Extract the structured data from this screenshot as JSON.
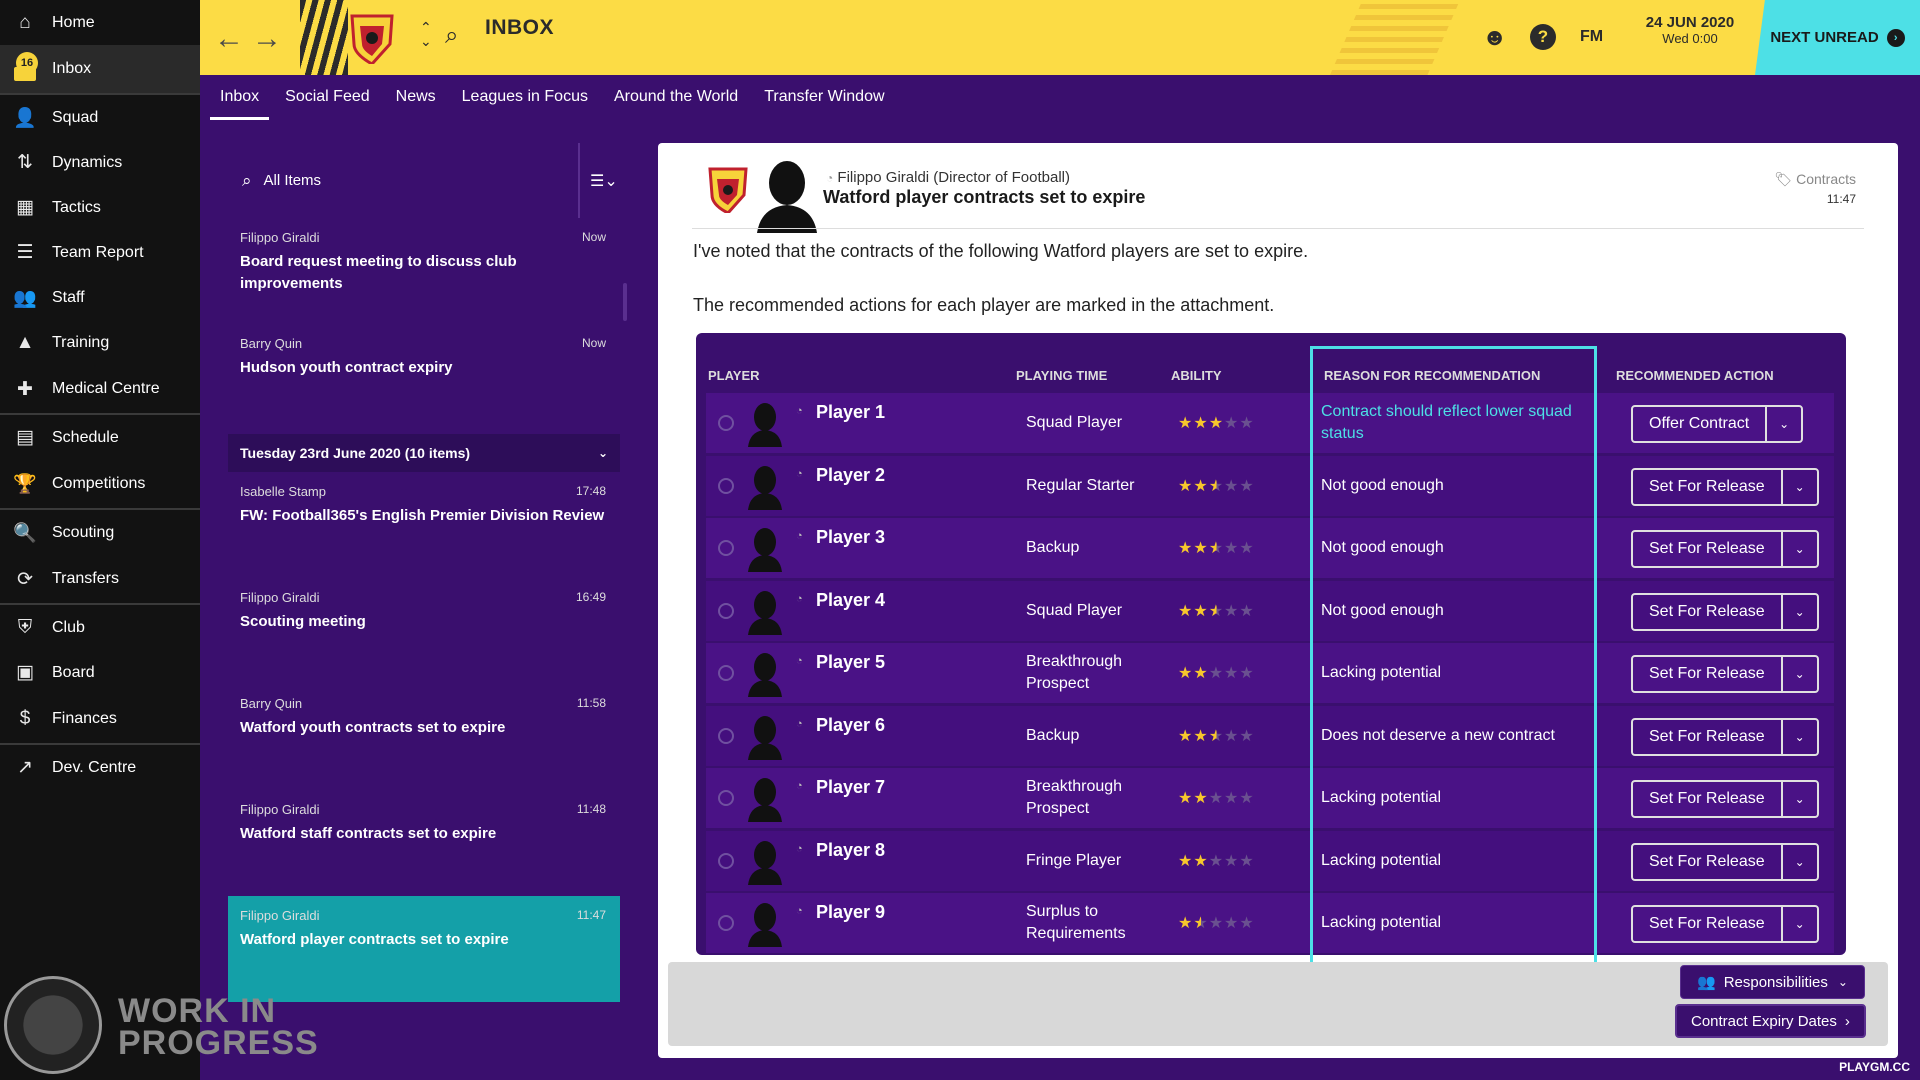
{
  "sidebar": {
    "items": [
      {
        "label": "Home",
        "icon": "home-icon",
        "glyph": "⌂"
      },
      {
        "label": "Inbox",
        "icon": "inbox-icon",
        "badge": "16"
      },
      {
        "label": "Squad",
        "icon": "squad-icon",
        "glyph": "👤"
      },
      {
        "label": "Dynamics",
        "icon": "dynamics-icon",
        "glyph": "⇅"
      },
      {
        "label": "Tactics",
        "icon": "tactics-icon",
        "glyph": "▦"
      },
      {
        "label": "Team Report",
        "icon": "report-icon",
        "glyph": "☰"
      },
      {
        "label": "Staff",
        "icon": "staff-icon",
        "glyph": "👥"
      },
      {
        "label": "Training",
        "icon": "training-icon",
        "glyph": "▲"
      },
      {
        "label": "Medical Centre",
        "icon": "medical-icon",
        "glyph": "✚"
      },
      {
        "label": "Schedule",
        "icon": "schedule-icon",
        "glyph": "▤"
      },
      {
        "label": "Competitions",
        "icon": "trophy-icon",
        "glyph": "🏆"
      },
      {
        "label": "Scouting",
        "icon": "scouting-icon",
        "glyph": "🔍"
      },
      {
        "label": "Transfers",
        "icon": "transfers-icon",
        "glyph": "⟳"
      },
      {
        "label": "Club",
        "icon": "club-icon",
        "glyph": "⛨"
      },
      {
        "label": "Board",
        "icon": "board-icon",
        "glyph": "▣"
      },
      {
        "label": "Finances",
        "icon": "finances-icon",
        "glyph": "$"
      },
      {
        "label": "Dev. Centre",
        "icon": "dev-centre-icon",
        "glyph": "↗"
      }
    ]
  },
  "header": {
    "title": "INBOX",
    "fm_label": "FM",
    "date": "24 JUN 2020",
    "day_time": "Wed 0:00",
    "next_unread": "NEXT UNREAD"
  },
  "tabs": [
    "Inbox",
    "Social Feed",
    "News",
    "Leagues in Focus",
    "Around the World",
    "Transfer Window"
  ],
  "list": {
    "search_label": "All Items",
    "messages_top": [
      {
        "from": "Filippo Giraldi",
        "time": "Now",
        "subject": "Board request meeting to discuss club improvements"
      },
      {
        "from": "Barry Quin",
        "time": "Now",
        "subject": "Hudson youth contract expiry"
      }
    ],
    "group_label": "Tuesday 23rd June 2020 (10 items)",
    "messages_group": [
      {
        "from": "Isabelle Stamp",
        "time": "17:48",
        "subject": "FW: Football365's English Premier Division Review"
      },
      {
        "from": "Filippo Giraldi",
        "time": "16:49",
        "subject": "Scouting meeting"
      },
      {
        "from": "Barry Quin",
        "time": "11:58",
        "subject": "Watford youth contracts set to expire"
      },
      {
        "from": "Filippo Giraldi",
        "time": "11:48",
        "subject": "Watford staff contracts set to expire"
      },
      {
        "from": "Filippo Giraldi",
        "time": "11:47",
        "subject": "Watford player contracts set to expire"
      }
    ]
  },
  "detail": {
    "from_name": "Filippo Giraldi",
    "from_role": "(Director of Football)",
    "subject": "Watford player contracts set to expire",
    "tag": "Contracts",
    "time": "11:47",
    "para1": "I've noted that the contracts of the following Watford players are set to expire.",
    "para2": "The recommended actions for each player are marked in the attachment."
  },
  "table": {
    "headers": {
      "player": "PLAYER",
      "time": "PLAYING TIME",
      "ability": "ABILITY",
      "reason": "REASON FOR RECOMMENDATION",
      "action": "RECOMMENDED ACTION"
    },
    "rows": [
      {
        "name": "Player 1",
        "time": "Squad Player",
        "stars": 3,
        "reason": "Contract should reflect lower squad status",
        "action": "Offer Contract",
        "highlight": true
      },
      {
        "name": "Player 2",
        "time": "Regular Starter",
        "stars": 2.5,
        "reason": "Not good enough",
        "action": "Set For Release"
      },
      {
        "name": "Player 3",
        "time": "Backup",
        "stars": 2.5,
        "reason": "Not good enough",
        "action": "Set For Release"
      },
      {
        "name": "Player 4",
        "time": "Squad Player",
        "stars": 2.5,
        "reason": "Not good enough",
        "action": "Set For Release"
      },
      {
        "name": "Player 5",
        "time": "Breakthrough Prospect",
        "stars": 2,
        "reason": "Lacking potential",
        "action": "Set For Release"
      },
      {
        "name": "Player 6",
        "time": "Backup",
        "stars": 2.5,
        "reason": "Does not deserve a new contract",
        "action": "Set For Release"
      },
      {
        "name": "Player 7",
        "time": "Breakthrough Prospect",
        "stars": 2,
        "reason": "Lacking potential",
        "action": "Set For Release"
      },
      {
        "name": "Player 8",
        "time": "Fringe Player",
        "stars": 2,
        "reason": "Lacking potential",
        "action": "Set For Release"
      },
      {
        "name": "Player 9",
        "time": "Surplus to Requirements",
        "stars": 1.5,
        "reason": "Lacking potential",
        "action": "Set For Release"
      }
    ]
  },
  "footer": {
    "responsibilities": "Responsibilities",
    "contract_expiry": "Contract Expiry Dates"
  },
  "overlay": {
    "wip_line1": "WORK IN",
    "wip_line2": "PROGRESS",
    "watermark": "PLAYGM.CC"
  },
  "colors": {
    "header_yellow": "#fcdc45",
    "accent_cyan": "#4de0e6",
    "purple_bg": "#3a0f6e",
    "star_gold": "#f7c72c"
  }
}
